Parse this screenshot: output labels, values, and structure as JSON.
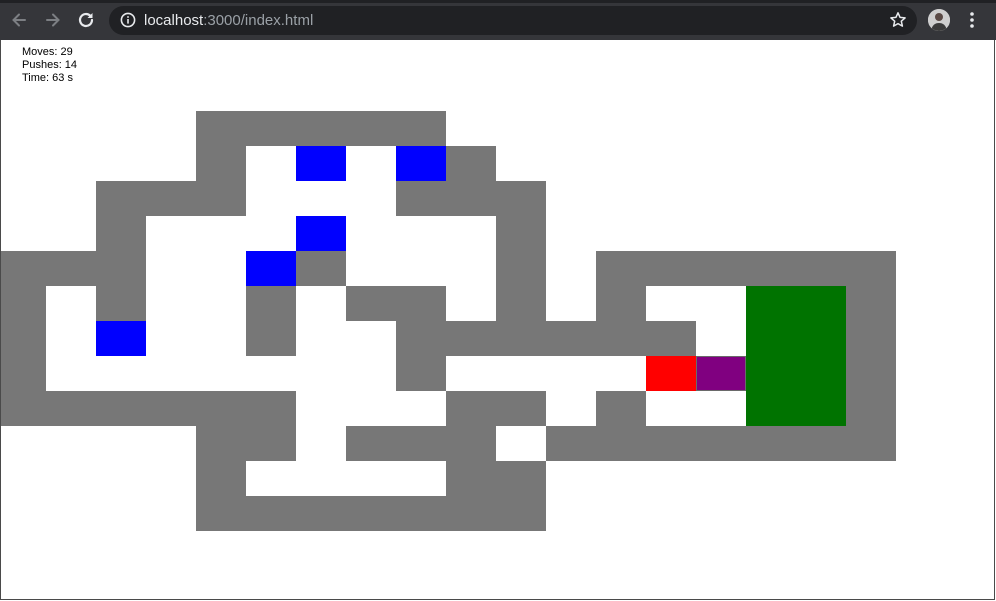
{
  "browser": {
    "url_host": "localhost",
    "url_path": ":3000/index.html",
    "icons": {
      "back": "arrow-left-icon",
      "forward": "arrow-right-icon",
      "reload": "reload-icon",
      "info": "info-icon",
      "bookmark": "star-icon",
      "profile": "avatar",
      "menu": "kebab-menu-icon"
    }
  },
  "stats": {
    "moves": "Moves: 29",
    "pushes": "Pushes: 14",
    "time": "Time: 63 s"
  },
  "colors": {
    "wall": "#777777",
    "floor": "#ffffff",
    "goal": "#007300",
    "box": "#0000ff",
    "box_on_goal": "#800080",
    "player": "#ff0000"
  },
  "board": {
    "legend": {
      "#": "wall",
      ".": "goal",
      "$": "box",
      "*": "box-on-goal",
      "@": "player",
      " ": "floor",
      "_": "outside"
    },
    "rows": [
      "____#####_________",
      "____# $ $#________",
      "__###   ###_______",
      "__#   $   #_______",
      "###  $#   #_######",
      "# #  # ## #_#  ..#",
      "# $  #  ###### ..#",
      "#       #    @*..#",
      "######   ## #  ..#",
      "____## ### #######",
      "____#    ##_______",
      "____#######_______"
    ]
  }
}
